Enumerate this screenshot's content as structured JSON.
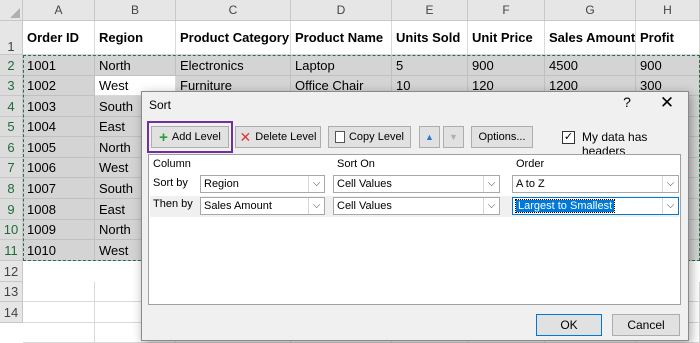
{
  "sheet": {
    "columns": [
      "A",
      "B",
      "C",
      "D",
      "E",
      "F",
      "G",
      "H"
    ],
    "rows": [
      "1",
      "2",
      "3",
      "4",
      "5",
      "6",
      "7",
      "8",
      "9",
      "10",
      "11",
      "12",
      "13",
      "14"
    ],
    "headers": [
      "Order ID",
      "Region",
      "Product Category",
      "Product Name",
      "Units Sold",
      "Unit Price",
      "Sales Amount",
      "Profit"
    ],
    "data": [
      [
        "1001",
        "North",
        "Electronics",
        "Laptop",
        "5",
        "900",
        "4500",
        "900"
      ],
      [
        "1002",
        "West",
        "Furniture",
        "Office Chair",
        "10",
        "120",
        "1200",
        "300"
      ],
      [
        "1003",
        "South",
        "",
        "",
        "",
        "",
        "",
        ""
      ],
      [
        "1004",
        "East",
        "",
        "",
        "",
        "",
        "",
        ""
      ],
      [
        "1005",
        "North",
        "",
        "",
        "",
        "",
        "",
        ""
      ],
      [
        "1006",
        "West",
        "",
        "",
        "",
        "",
        "",
        ""
      ],
      [
        "1007",
        "South",
        "",
        "",
        "",
        "",
        "",
        ""
      ],
      [
        "1008",
        "East",
        "",
        "",
        "",
        "",
        "",
        ""
      ],
      [
        "1009",
        "North",
        "",
        "",
        "",
        "",
        "",
        ""
      ],
      [
        "1010",
        "West",
        "",
        "",
        "",
        "",
        "",
        ""
      ]
    ]
  },
  "dialog": {
    "title": "Sort",
    "help": "?",
    "close": "✕",
    "toolbar": {
      "add_level": "Add Level",
      "delete_level": "Delete Level",
      "copy_level": "Copy Level",
      "move_up": "▲",
      "move_down": "▼",
      "options": "Options..."
    },
    "my_data_has_headers": {
      "label": "My data has headers",
      "checked": true
    },
    "grid": {
      "col_column": "Column",
      "col_sort_on": "Sort On",
      "col_order": "Order",
      "levels": [
        {
          "label": "Sort by",
          "column": "Region",
          "sort_on": "Cell Values",
          "order": "A to Z"
        },
        {
          "label": "Then by",
          "column": "Sales Amount",
          "sort_on": "Cell Values",
          "order": "Largest to Smallest"
        }
      ]
    },
    "ok": "OK",
    "cancel": "Cancel"
  },
  "colors": {
    "accent_highlight": "#7030a0",
    "selection_blue": "#0078d7",
    "excel_green": "#217346"
  }
}
